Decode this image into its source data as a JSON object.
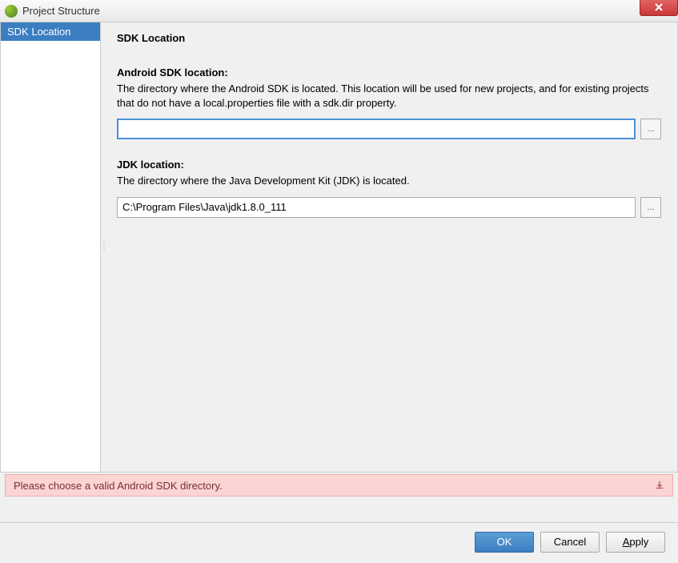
{
  "window": {
    "title": "Project Structure"
  },
  "sidebar": {
    "items": [
      {
        "label": "SDK Location",
        "selected": true
      }
    ]
  },
  "content": {
    "title": "SDK Location",
    "android_sdk": {
      "label": "Android SDK location:",
      "description": "The directory where the Android SDK is located. This location will be used for new projects, and for existing projects that do not have a local.properties file with a sdk.dir property.",
      "value": "",
      "browse": "..."
    },
    "jdk": {
      "label": "JDK location:",
      "description": "The directory where the Java Development Kit (JDK) is located.",
      "value": "C:\\Program Files\\Java\\jdk1.8.0_111",
      "browse": "..."
    }
  },
  "error": {
    "message": "Please choose a valid Android SDK directory."
  },
  "buttons": {
    "ok": "OK",
    "cancel": "Cancel",
    "apply": "Apply"
  }
}
